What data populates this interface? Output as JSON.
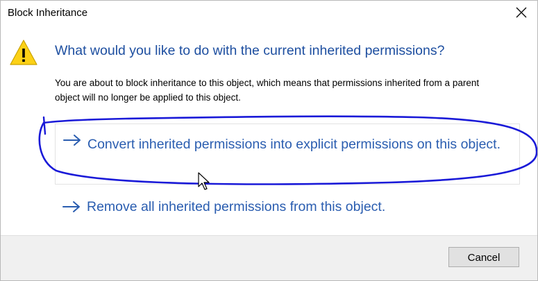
{
  "window": {
    "title": "Block Inheritance",
    "close_icon": "close-icon"
  },
  "dialog": {
    "icon": "warning-icon",
    "main_instruction": "What would you like to do with the current inherited permissions?",
    "content_text": "You are about to block inheritance to this object, which means that permissions inherited from a parent object will no longer be applied to this object."
  },
  "command_links": [
    {
      "icon": "arrow-right-icon",
      "label": "Convert inherited permissions into explicit permissions on this object."
    },
    {
      "icon": "arrow-right-icon",
      "label": "Remove all inherited permissions from this object."
    }
  ],
  "footer": {
    "cancel_label": "Cancel"
  },
  "colors": {
    "instruction_blue": "#1e4fa0",
    "link_blue": "#2a5db0",
    "annotation_ink": "#1a1ad8",
    "warning_yellow": "#fcd116"
  }
}
